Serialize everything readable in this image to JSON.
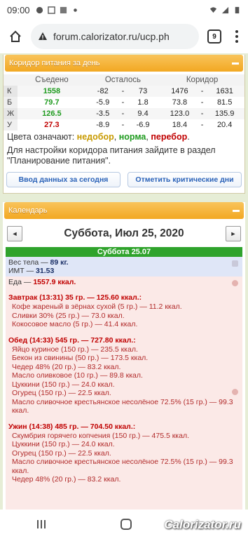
{
  "status": {
    "time": "09:00"
  },
  "browser": {
    "url": "forum.calorizator.ru/ucp.ph",
    "tabs_count": "9"
  },
  "corridor": {
    "title": "Коридор питания за день",
    "headers": [
      "",
      "Съедено",
      "Осталось",
      "Коридор"
    ],
    "rows": [
      {
        "label": "К",
        "eaten": "1558",
        "r1": "-82",
        "sep": "-",
        "r2": "73",
        "c1": "1476",
        "c2": "1631",
        "eaten_class": "green"
      },
      {
        "label": "Б",
        "eaten": "79.7",
        "r1": "-5.9",
        "sep": "-",
        "r2": "1.8",
        "c1": "73.8",
        "c2": "81.5",
        "eaten_class": "green"
      },
      {
        "label": "Ж",
        "eaten": "126.5",
        "r1": "-3.5",
        "sep": "-",
        "r2": "9.4",
        "c1": "123.0",
        "c2": "135.9",
        "eaten_class": "green"
      },
      {
        "label": "У",
        "eaten": "27.3",
        "r1": "-8.9",
        "sep": "-",
        "r2": "-6.9",
        "c1": "18.4",
        "c2": "20.4",
        "eaten_class": "red"
      }
    ],
    "colors_note_prefix": "Цвета означают: ",
    "colors_nedobor": "недобор",
    "colors_norma": "норма",
    "colors_perebor": "перебор",
    "settings_note": "Для настройки коридора питания зайдите в раздел \"Планирование питания\".",
    "btn_enter": "Ввод данных за сегодня",
    "btn_critical": "Отметить критические дни"
  },
  "calendar": {
    "title": "Календарь",
    "date_title": "Суббота, Июл 25, 2020",
    "day_header": "Суббота 25.07",
    "weight_label": "Вес тела — ",
    "weight_value": "89 кг.",
    "bmi_label": "ИМТ — ",
    "bmi_value": "31.53",
    "food_label": "Еда — ",
    "food_total": "1557.9 ккал.",
    "meals": [
      {
        "title": "Завтрак (13:31) 35 гр. — 125.60 ккал.:",
        "items": [
          "Кофе жареный в зёрнах сухой (5 гр.) — 11.2 ккал.",
          "Сливки 30% (25 гр.) — 73.0 ккал.",
          "Кокосовое масло (5 гр.) — 41.4 ккал."
        ]
      },
      {
        "title": "Обед (14:33) 545 гр. — 727.80 ккал.:",
        "items": [
          "Яйцо куриное (150 гр.) — 235.5 ккал.",
          "Бекон из свинины (50 гр.) — 173.5 ккал.",
          "Чедер 48% (20 гр.) — 83.2 ккал.",
          "Масло оливковое (10 гр.) — 89.8 ккал.",
          "Цуккини (150 гр.) — 24.0 ккал.",
          "Огурец (150 гр.) — 22.5 ккал.",
          "Масло сливочное крестьянское несолёное 72.5% (15 гр.) — 99.3 ккал."
        ]
      },
      {
        "title": "Ужин (14:38) 485 гр. — 704.50 ккал.:",
        "items": [
          "Скумбрия горячего копчения (150 гр.) — 475.5 ккал.",
          "Цуккини (150 гр.) — 24.0 ккал.",
          "Огурец (150 гр.) — 22.5 ккал.",
          "Масло сливочное крестьянское несолёное 72.5% (15 гр.) — 99.3 ккал.",
          "Чедер 48% (20 гр.) — 83.2 ккал."
        ]
      }
    ]
  },
  "watermark": "Calorizator.ru"
}
